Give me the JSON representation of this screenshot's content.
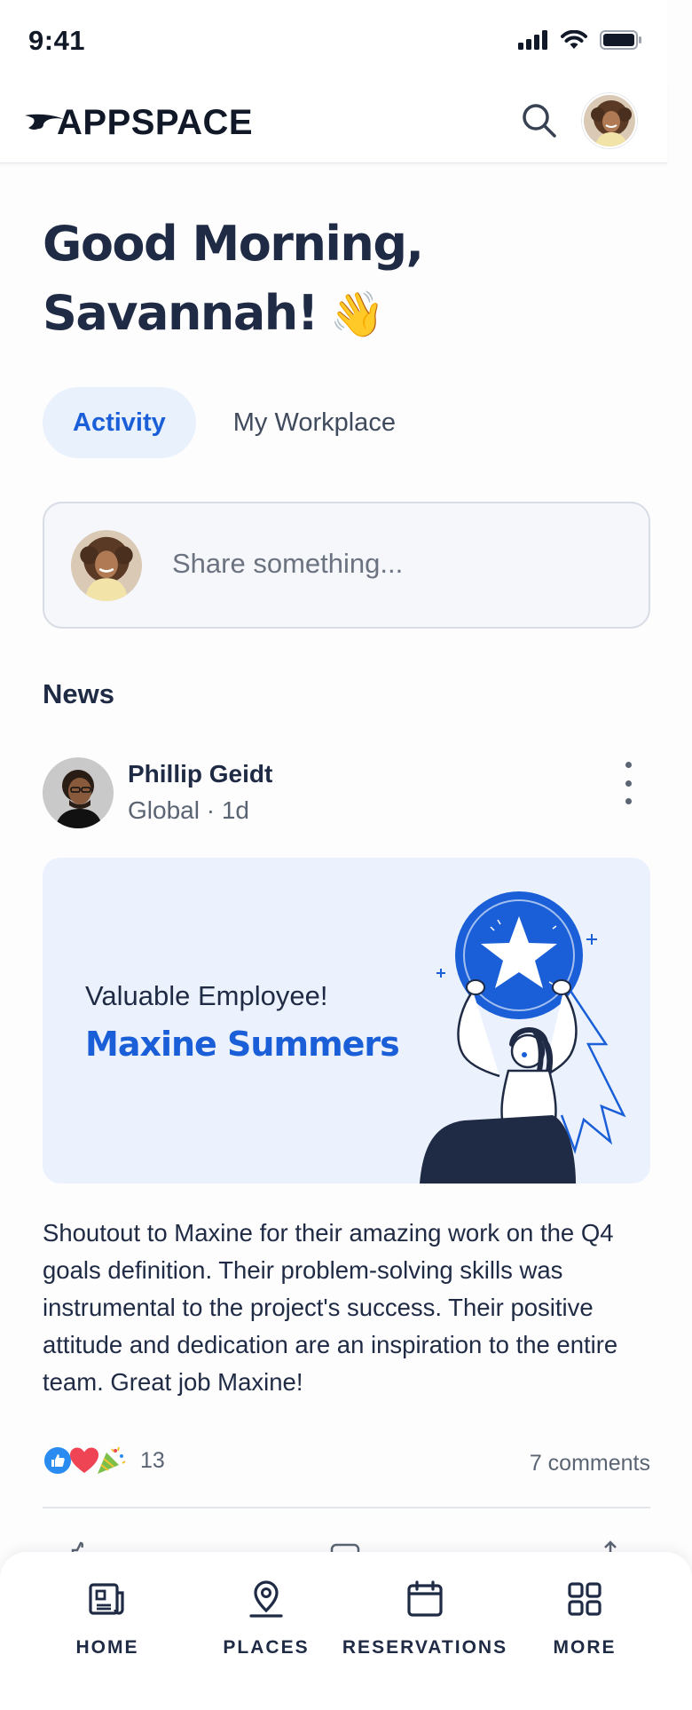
{
  "status_bar": {
    "time": "9:41"
  },
  "header": {
    "logo_text": "APPSPACE",
    "search_icon": "search-icon",
    "avatar_icon": "user-avatar"
  },
  "greeting": {
    "line1": "Good Morning,",
    "line2": "Savannah!",
    "emoji": "👋"
  },
  "tabs": [
    {
      "label": "Activity",
      "active": true
    },
    {
      "label": "My Workplace",
      "active": false
    }
  ],
  "composer": {
    "placeholder": "Share something..."
  },
  "news": {
    "title": "News",
    "post": {
      "author": "Phillip Geidt",
      "meta": "Global · 1d",
      "banner_label": "Valuable Employee!",
      "banner_name": "Maxine Summers",
      "body": "Shoutout to Maxine for their amazing work on the Q4 goals definition. Their problem-solving skills was instrumental to the project's success. Their positive attitude and dedication are an inspiration to the entire team. Great job Maxine!",
      "reaction_icons": [
        "thumbs-up-icon",
        "heart-icon",
        "party-popper-icon"
      ],
      "reaction_count": "13",
      "comments": "7 comments"
    }
  },
  "bottom_nav": [
    {
      "label": "HOME",
      "icon": "newspaper-icon"
    },
    {
      "label": "PLACES",
      "icon": "map-pin-icon"
    },
    {
      "label": "RESERVATIONS",
      "icon": "calendar-icon"
    },
    {
      "label": "MORE",
      "icon": "grid-icon"
    }
  ],
  "colors": {
    "accent": "#1a5fd8",
    "text": "#1f2a44",
    "muted": "#5b6473",
    "tab_active_bg": "#e9f1fd",
    "banner_bg": "#ecf2fd"
  }
}
